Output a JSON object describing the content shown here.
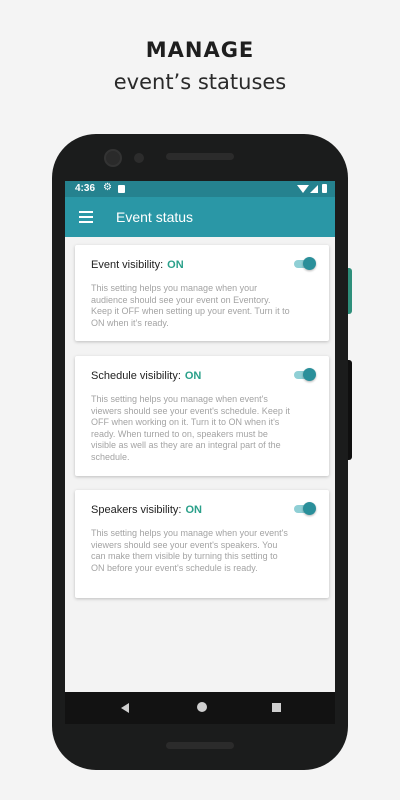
{
  "promo": {
    "headline": "MANAGE",
    "subheadline": "event’s statuses"
  },
  "statusbar": {
    "time": "4:36",
    "icons": [
      "gear-icon",
      "sd-card-icon",
      "wifi-icon",
      "signal-icon",
      "battery-icon"
    ]
  },
  "appbar": {
    "title": "Event status",
    "menu_icon": "hamburger-menu-icon"
  },
  "cards": [
    {
      "label": "Event visibility:",
      "status": "ON",
      "toggle_on": true,
      "description": "This setting helps you manage when your audience should see your event on Eventory. Keep it OFF when setting up your event. Turn it to ON when it’s ready."
    },
    {
      "label": "Schedule visibility:",
      "status": "ON",
      "toggle_on": true,
      "description": "This setting helps you manage when event's viewers should see your event's schedule. Keep it OFF when working on it. Turn it to ON when it's ready. When turned to on, speakers must be visible as well as they are an integral part of the schedule."
    },
    {
      "label": "Speakers visibility:",
      "status": "ON",
      "toggle_on": true,
      "description": "This setting helps you manage when your event's viewers should see your event's speakers. You can make them visible by turning this setting to ON before your event's schedule is ready."
    }
  ],
  "navbar": {
    "icons": [
      "back-icon",
      "home-icon",
      "recents-icon"
    ]
  },
  "colors": {
    "appbar": "#2a97a6",
    "statusbar": "#25828f",
    "status_on": "#2aa08a",
    "toggle_knob": "#2a8f9a",
    "toggle_track": "#8fcfd5"
  }
}
